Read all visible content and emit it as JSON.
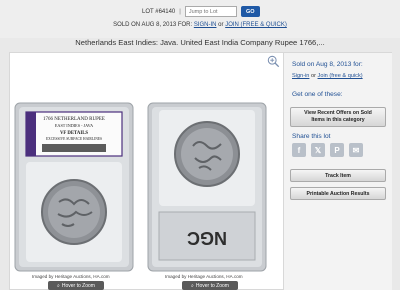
{
  "header": {
    "lot_label": "LOT #64140",
    "separator": "|",
    "jump_placeholder": "Jump to Lot",
    "go_label": "GO",
    "sold_prefix": "SOLD ON AUG 8, 2013 FOR:",
    "sign_in": "SIGN-IN",
    "or": "or",
    "join": "JOIN (FREE & QUICK)"
  },
  "title": "Netherlands East Indies: Java. United East India Company Rupee 1766,...",
  "images": {
    "credit_left": "Imaged by Heritage Auctions, HA.com",
    "credit_right": "Imaged by Heritage Auctions, HA.com",
    "hover_zoom": "Hover to Zoom",
    "slab_label_lines": [
      "1766 NETHERLAND RUPEE",
      "EAST INDIES - JAVA",
      "VF DETAILS",
      "EXCESSIVE SURFACE HAIRLINES"
    ],
    "slab_logo": "NGC"
  },
  "sidebar": {
    "sold_on": "Sold on Aug 8, 2013 for:",
    "sign_in": "Sign-in",
    "or": "or",
    "join": "Join (free & quick)",
    "get_one": "Get one of these:",
    "recent_offers": "View Recent Offers on Sold Items in this category",
    "share": "Share this lot",
    "track_item": "Track Item",
    "printable": "Printable Auction Results"
  },
  "colors": {
    "accent": "#1f4f93",
    "go_button": "#1f59a6",
    "slab_purple": "#4b2f7d"
  }
}
